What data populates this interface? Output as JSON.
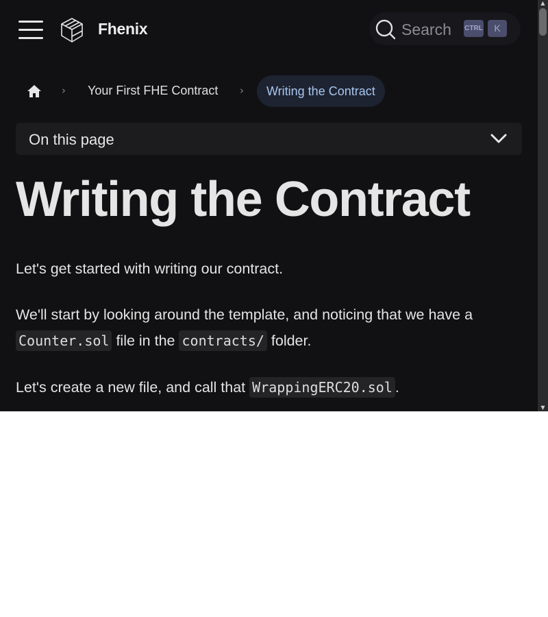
{
  "header": {
    "brand": "Fhenix",
    "search": {
      "label": "Search",
      "shortcut_modifier": "CTRL",
      "shortcut_key": "K"
    }
  },
  "breadcrumb": {
    "items": [
      {
        "label": "Your First FHE Contract"
      },
      {
        "label": "Writing the Contract"
      }
    ]
  },
  "toc": {
    "label": "On this page"
  },
  "article": {
    "title": "Writing the Contract",
    "p1": "Let's get started with writing our contract.",
    "p2": {
      "before": "We'll start by looking around the template, and noticing that we have a",
      "code1": "Counter.sol",
      "mid": "file in the",
      "code2": "contracts/",
      "after": "folder."
    },
    "p3": {
      "before": "Let's create a new file, and call that",
      "code": "WrappingERC20.sol",
      "after": "."
    }
  },
  "colors": {
    "background": "#111113",
    "accent": "#a9c6ef",
    "kbd": "#4a4d6b"
  },
  "icons": [
    "menu-icon",
    "fhenix-logo-icon",
    "search-icon",
    "home-icon",
    "chevron-right-icon",
    "chevron-down-icon"
  ]
}
